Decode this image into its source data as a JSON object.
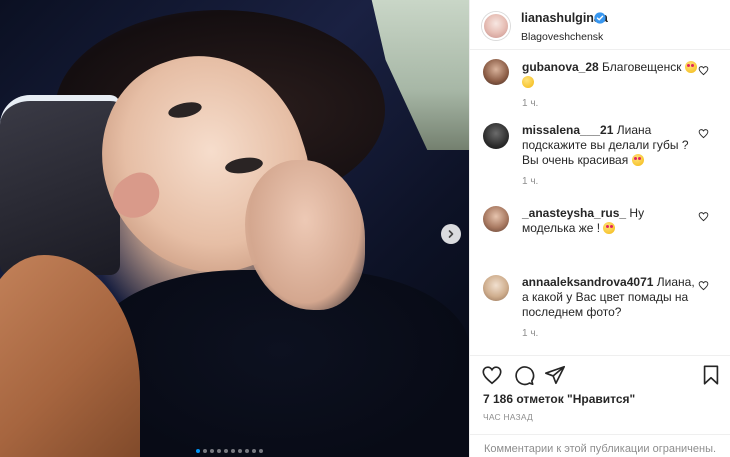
{
  "post": {
    "username": "lianashulginaa",
    "location": "Blagoveshchensk",
    "carousel": {
      "dots": 10,
      "active_index": 0
    }
  },
  "comments": [
    {
      "user": "gubanova_28",
      "text": "Благовещенск",
      "time": "1 ч."
    },
    {
      "user": "missalena___21",
      "text": "Лиана подскажите вы делали губы ? Вы очень красивая",
      "time": "1 ч."
    },
    {
      "user": "_anasteysha_rus_",
      "text": "Ну моделька же !",
      "time": ""
    },
    {
      "user": "annaaleksandrova4071",
      "text": "Лиана, а какой у Вас цвет помады на последнем фото?",
      "time": "1 ч."
    }
  ],
  "actions": {
    "likes": "7 186 отметок \"Нравится\"",
    "time_ago": "ЧАС НАЗАД",
    "comments_closed": "Комментарии к этой публикации ограничены."
  },
  "icons": [
    "verified-icon",
    "heart-icon",
    "comment-icon",
    "share-icon",
    "bookmark-icon",
    "chevron-right-icon"
  ],
  "colors": {
    "accent": "#0095f6",
    "text": "#262626",
    "muted": "#8e8e8e"
  }
}
